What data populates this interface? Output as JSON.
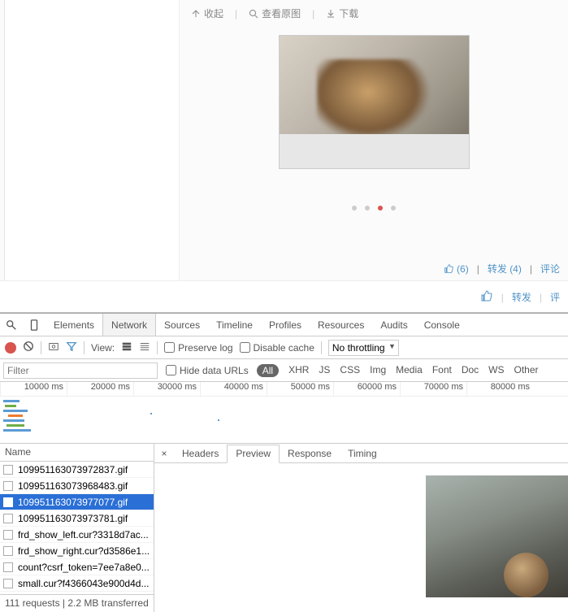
{
  "page": {
    "toolbar": {
      "collapse": "收起",
      "view_original": "查看原图",
      "download": "下载"
    },
    "actions": {
      "like_count": "(6)",
      "forward_label": "转发",
      "forward_count": "(4)",
      "comment_label": "评论"
    },
    "ctx": {
      "forward": "转发",
      "review": "评"
    }
  },
  "devtools": {
    "tabs": [
      "Elements",
      "Network",
      "Sources",
      "Timeline",
      "Profiles",
      "Resources",
      "Audits",
      "Console"
    ],
    "active_tab": "Network",
    "toolbar": {
      "view_label": "View:",
      "preserve_log": "Preserve log",
      "disable_cache": "Disable cache",
      "throttling": "No throttling"
    },
    "filterbar": {
      "filter_placeholder": "Filter",
      "hide_data_urls": "Hide data URLs",
      "types": [
        "All",
        "XHR",
        "JS",
        "CSS",
        "Img",
        "Media",
        "Font",
        "Doc",
        "WS",
        "Other"
      ],
      "active_type": "All"
    },
    "timeline": {
      "ticks": [
        "10000 ms",
        "20000 ms",
        "30000 ms",
        "40000 ms",
        "50000 ms",
        "60000 ms",
        "70000 ms",
        "80000 ms"
      ]
    },
    "request_list": {
      "header": "Name",
      "rows": [
        {
          "name": "109951163073972837.gif"
        },
        {
          "name": "109951163073968483.gif"
        },
        {
          "name": "109951163073977077.gif",
          "selected": true
        },
        {
          "name": "109951163073973781.gif"
        },
        {
          "name": "frd_show_left.cur?3318d7ac..."
        },
        {
          "name": "frd_show_right.cur?d3586e1..."
        },
        {
          "name": "count?csrf_token=7ee7a8e0..."
        },
        {
          "name": "small.cur?f4366043e900d4d..."
        }
      ],
      "status": "111 requests  |  2.2 MB transferred"
    },
    "detail": {
      "tabs": [
        "Headers",
        "Preview",
        "Response",
        "Timing"
      ],
      "active": "Preview"
    }
  }
}
